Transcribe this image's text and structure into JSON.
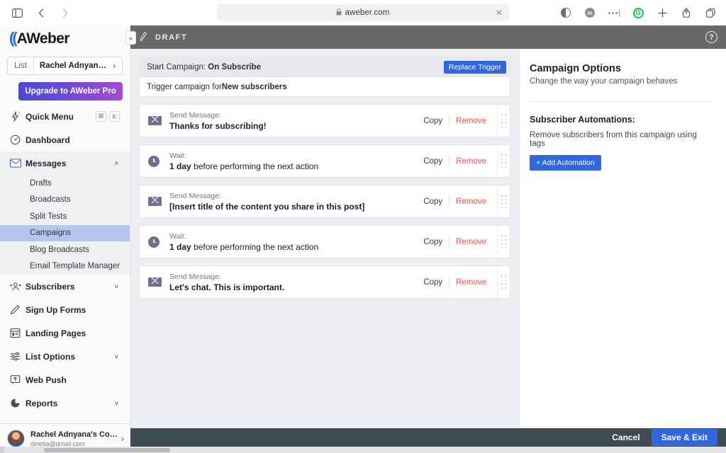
{
  "browser": {
    "url": "aweber.com",
    "lock_icon": "lock-icon",
    "close_tab_icon": "close-icon",
    "back_icon": "chevron-left-icon",
    "forward_icon": "chevron-right-icon",
    "sidebar_toggle_icon": "sidebar-toggle-icon",
    "toolbar_icons": [
      "reader-mode-icon",
      "extension-icon",
      "more-extensions-icon",
      "grammarly-icon",
      "new-tab-icon",
      "share-icon",
      "tabs-overview-icon"
    ],
    "extension_badge_letter": "m",
    "grammarly_letter": "G",
    "new_tab_glyph": "+"
  },
  "sidebar": {
    "logo_text": "AWeber",
    "logo_mark": "((",
    "list_selector": {
      "label": "List",
      "value": "Rachel Adnyana's List",
      "chevron": "›"
    },
    "upgrade_label": "Upgrade to AWeber Pro",
    "collapse_label": "«",
    "items": [
      {
        "label": "Quick Menu",
        "icon": "lightning-icon",
        "shortcut": [
          "⌘",
          "K"
        ]
      },
      {
        "label": "Dashboard",
        "icon": "speedometer-icon"
      },
      {
        "label": "Messages",
        "icon": "envelope-icon",
        "caret": "˄",
        "expanded": true
      },
      {
        "label": "Subscribers",
        "icon": "people-icon",
        "caret": "˅"
      },
      {
        "label": "Sign Up Forms",
        "icon": "pencil-icon"
      },
      {
        "label": "Landing Pages",
        "icon": "page-icon"
      },
      {
        "label": "List Options",
        "icon": "sliders-icon",
        "caret": "˅"
      },
      {
        "label": "Web Push",
        "icon": "push-icon"
      },
      {
        "label": "Reports",
        "icon": "pie-chart-icon",
        "caret": "˅"
      }
    ],
    "messages_subitems": [
      {
        "label": "Drafts",
        "active": false
      },
      {
        "label": "Broadcasts",
        "active": false
      },
      {
        "label": "Split Tests",
        "active": false
      },
      {
        "label": "Campaigns",
        "active": true
      },
      {
        "label": "Blog Broadcasts",
        "active": false
      },
      {
        "label": "Email Template Manager",
        "active": false
      }
    ],
    "account": {
      "name": "Rachel Adnyana's Com…",
      "email": "deletia@gmail.com",
      "chevron": "›",
      "avatar": "avatar"
    }
  },
  "topbar": {
    "status": "DRAFT",
    "edit_icon": "pencil-icon",
    "help_icon": "question-mark-icon",
    "help_glyph": "?"
  },
  "trigger": {
    "title_prefix": "Start Campaign: ",
    "title_value": "On Subscribe",
    "replace_label": "Replace Trigger",
    "body_prefix": "Trigger campaign for ",
    "body_value": "New subscribers"
  },
  "steps": [
    {
      "icon": "envelope-icon",
      "type": "message",
      "label": "Send Message:",
      "value": "Thanks for subscribing!",
      "value_suffix": "",
      "copy_label": "Copy",
      "remove_label": "Remove"
    },
    {
      "icon": "clock-icon",
      "type": "wait",
      "label": "Wait:",
      "value": "1 day",
      "value_suffix": " before performing the next action",
      "copy_label": "Copy",
      "remove_label": "Remove"
    },
    {
      "icon": "envelope-icon",
      "type": "message",
      "label": "Send Message:",
      "value": "[Insert title of the content you share in this post]",
      "value_suffix": "",
      "copy_label": "Copy",
      "remove_label": "Remove"
    },
    {
      "icon": "clock-icon",
      "type": "wait",
      "label": "Wait:",
      "value": "1 day",
      "value_suffix": " before performing the next action",
      "copy_label": "Copy",
      "remove_label": "Remove"
    },
    {
      "icon": "envelope-icon",
      "type": "message",
      "label": "Send Message:",
      "value": "Let's chat. This is important.",
      "value_suffix": "",
      "copy_label": "Copy",
      "remove_label": "Remove"
    }
  ],
  "options_panel": {
    "title": "Campaign Options",
    "subtitle": "Change the way your campaign behaves",
    "section_title": "Subscriber Automations:",
    "section_text": "Remove subscribers from this campaign using tags",
    "add_automation_label": "+ Add Automation"
  },
  "footer": {
    "cancel_label": "Cancel",
    "save_label": "Save & Exit"
  },
  "colors": {
    "accent_blue": "#3066e0",
    "remove_red": "#e2574c",
    "topbar_gray": "#686868",
    "footer_slate": "#3f4b53",
    "active_subitem": "#b7c6ef",
    "canvas_bg": "#eceef1"
  }
}
